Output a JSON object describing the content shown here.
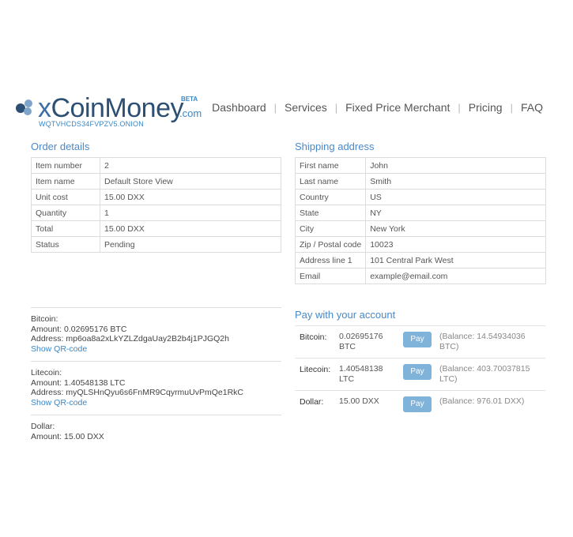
{
  "brand": {
    "x": "x",
    "name": "CoinMoney",
    "com": ".com",
    "beta": "BETA",
    "onion": "WQTVHCDS34FVPZV5.ONION",
    "colors": {
      "accent": "#4a89c8",
      "brand_dark": "#2d4f73",
      "button": "#7fb3d9"
    }
  },
  "nav": {
    "items": [
      "Dashboard",
      "Services",
      "Fixed Price Merchant",
      "Pricing",
      "FAQ"
    ],
    "separator": "|"
  },
  "order": {
    "title": "Order details",
    "rows": [
      {
        "label": "Item number",
        "value": "2"
      },
      {
        "label": "Item name",
        "value": "Default Store View"
      },
      {
        "label": "Unit cost",
        "value": "15.00 DXX"
      },
      {
        "label": "Quantity",
        "value": "1"
      },
      {
        "label": "Total",
        "value": "15.00 DXX"
      },
      {
        "label": "Status",
        "value": "Pending"
      }
    ]
  },
  "shipping": {
    "title": "Shipping address",
    "rows": [
      {
        "label": "First name",
        "value": "John"
      },
      {
        "label": "Last name",
        "value": "Smith"
      },
      {
        "label": "Country",
        "value": "US"
      },
      {
        "label": "State",
        "value": "NY"
      },
      {
        "label": "City",
        "value": "New York"
      },
      {
        "label": "Zip / Postal code",
        "value": "10023"
      },
      {
        "label": "Address line 1",
        "value": "101 Central Park West"
      },
      {
        "label": "Email",
        "value": "example@email.com"
      }
    ]
  },
  "payments": [
    {
      "currency": "Bitcoin:",
      "amount": "Amount: 0.02695176 BTC",
      "address": "Address: mp6oa8a2xLkYZLZdgaUay2B2b4j1PJGQ2h",
      "qr_link": "Show QR-code"
    },
    {
      "currency": "Litecoin:",
      "amount": "Amount: 1.40548138 LTC",
      "address": "Address: myQLSHnQyu6s6FnMR9CqyrmuUvPmQe1RkC",
      "qr_link": "Show QR-code"
    },
    {
      "currency": "Dollar:",
      "amount": "Amount: 15.00 DXX"
    }
  ],
  "account": {
    "title": "Pay with your account",
    "pay_label": "Pay",
    "rows": [
      {
        "currency": "Bitcoin:",
        "amount": "0.02695176 BTC",
        "balance": "(Balance: 14.54934036 BTC)"
      },
      {
        "currency": "Litecoin:",
        "amount": "1.40548138 LTC",
        "balance": "(Balance: 403.70037815 LTC)"
      },
      {
        "currency": "Dollar:",
        "amount": "15.00 DXX",
        "balance": "(Balance: 976.01 DXX)"
      }
    ]
  }
}
